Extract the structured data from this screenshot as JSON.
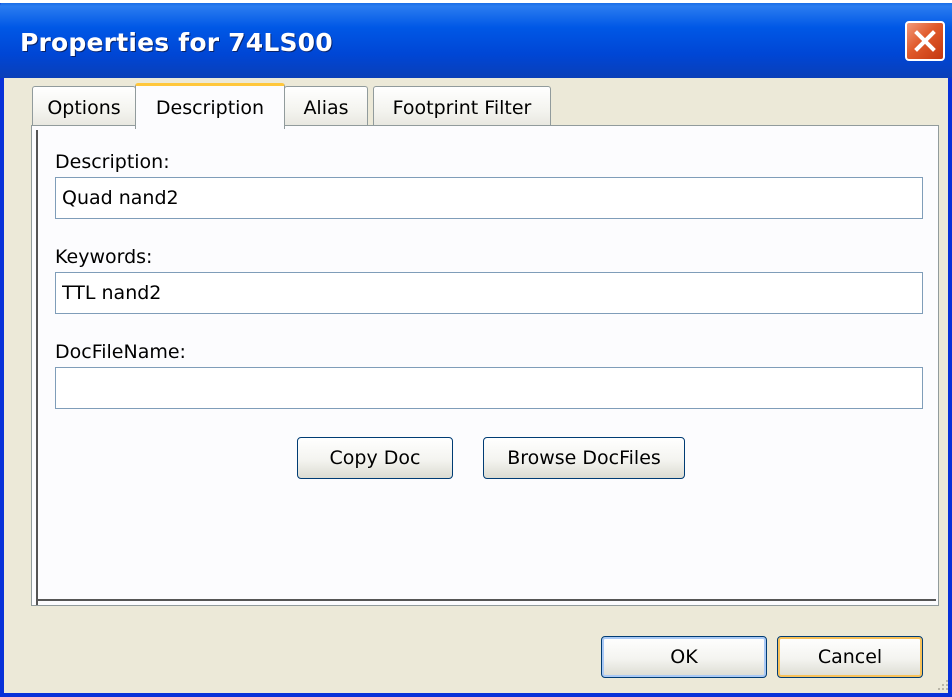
{
  "window": {
    "title": "Properties for 74LS00"
  },
  "tabs": [
    {
      "label": "Options",
      "active": false
    },
    {
      "label": "Description",
      "active": true
    },
    {
      "label": "Alias",
      "active": false
    },
    {
      "label": "Footprint Filter",
      "active": false
    }
  ],
  "description_tab": {
    "description_label": "Description:",
    "description_value": "Quad nand2",
    "keywords_label": "Keywords:",
    "keywords_value": "TTL nand2",
    "docfilename_label": "DocFileName:",
    "docfilename_value": "",
    "copy_doc_label": "Copy Doc",
    "browse_docfiles_label": "Browse DocFiles"
  },
  "footer": {
    "ok_label": "OK",
    "cancel_label": "Cancel"
  },
  "icons": {
    "close": "close-icon",
    "resize": "resize-grip-icon"
  },
  "colors": {
    "titlebar": "#0055e5",
    "window_bg": "#ece9d8",
    "close_button": "#e05a2b",
    "active_tab_accent": "#ffc73c"
  }
}
